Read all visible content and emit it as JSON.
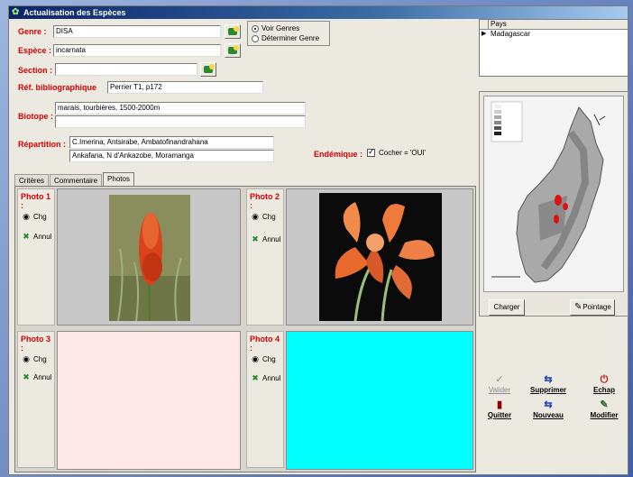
{
  "window": {
    "title": "Actualisation des Espèces"
  },
  "form": {
    "genre": {
      "label": "Genre :",
      "value": "DISA"
    },
    "espece": {
      "label": "Espèce :",
      "value": "incarnata"
    },
    "section": {
      "label": "Section :",
      "value": ""
    },
    "ref": {
      "label": "Réf. bibliographique",
      "value": "Perrier T1, p172"
    },
    "biotope": {
      "label": "Biotope :",
      "line1": "marais, tourbières, 1500-2000m",
      "line2": ""
    },
    "repartition": {
      "label": "Répartition :",
      "line1": "C.Imerina, Antsirabe, Ambatofinandrahana",
      "line2": "Ankafana, N d'Ankazobe, Moramanga"
    },
    "endemique": {
      "label": "Endémique :",
      "checkbox_label": "Cocher = 'OUI'",
      "checked": true
    }
  },
  "radio": {
    "options": [
      {
        "label": "Voir Genres",
        "selected": true
      },
      {
        "label": "Déterminer Genre",
        "selected": false
      }
    ]
  },
  "tabs": [
    {
      "label": "Critères",
      "active": false
    },
    {
      "label": "Commentaire",
      "active": false
    },
    {
      "label": "Photos",
      "active": true
    }
  ],
  "photos": [
    {
      "label": "Photo 1 :",
      "chg": "Chg",
      "annul": "Annul",
      "fill": "#c8c8c8"
    },
    {
      "label": "Photo 2 :",
      "chg": "Chg",
      "annul": "Annul",
      "fill": "#c8c8c8"
    },
    {
      "label": "Photo 3 :",
      "chg": "Chg",
      "annul": "Annul",
      "fill": "#fde7e7"
    },
    {
      "label": "Photo 4 :",
      "chg": "Chg",
      "annul": "Annul",
      "fill": "#00ffff"
    }
  ],
  "country_grid": {
    "header": "Pays",
    "rows": [
      "Madagascar"
    ]
  },
  "map": {
    "charger": "Charger",
    "pointage": "Pointage"
  },
  "actions": {
    "valider": "Valider",
    "supprimer": "Supprimer",
    "echap": "Echap",
    "quitter": "Quitter",
    "nouveau": "Nouveau",
    "modifier": "Modifier"
  },
  "colors": {
    "label_red": "#d40000",
    "photo4_bg": "#00ffff",
    "photo3_bg": "#fde7e7"
  }
}
